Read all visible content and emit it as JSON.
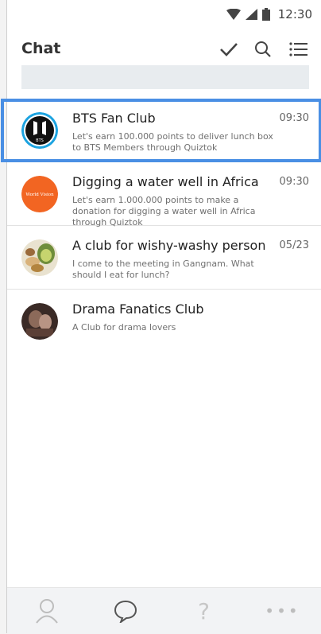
{
  "status_bar": {
    "time": "12:30",
    "icons": [
      "wifi-icon",
      "signal-icon",
      "battery-icon"
    ]
  },
  "header": {
    "title": "Chat",
    "actions": [
      "check-icon",
      "search-icon",
      "menu-list-icon"
    ]
  },
  "search": {
    "placeholder": ""
  },
  "chats": [
    {
      "title": "BTS Fan Club",
      "time": "09:30",
      "description": "Let's earn 100.000 points to deliver lunch box to BTS Members through Quiztok",
      "avatar_text": "BTS",
      "selected": true
    },
    {
      "title": "Digging a water well in Africa",
      "time": "09:30",
      "description": "Let's earn 1.000.000 points to make a donation for digging a water well in Africa through Quiztok",
      "avatar_text": "World Vision"
    },
    {
      "title": "A club for wishy-washy person",
      "time": "05/23",
      "description": "I come to the meeting in Gangnam. What should I eat for lunch?"
    },
    {
      "title": "Drama Fanatics Club",
      "time": "",
      "description": "A Club for drama lovers"
    }
  ],
  "tabs": [
    {
      "icon": "person-icon"
    },
    {
      "icon": "chat-bubble-icon",
      "active": true
    },
    {
      "icon": "help-icon",
      "text": "?"
    },
    {
      "icon": "more-icon",
      "text": "•••"
    }
  ],
  "colors": {
    "selection": "#4a8fe4",
    "world_vision": "#f26522",
    "bts_ring": "#1ca3e0"
  }
}
